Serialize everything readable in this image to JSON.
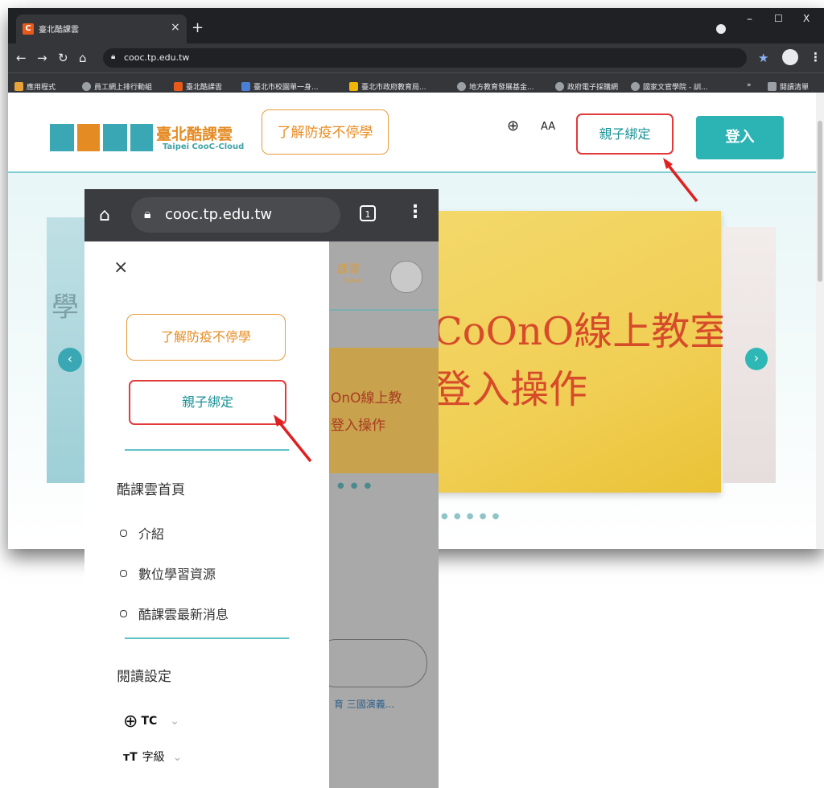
{
  "desktop": {
    "tab_title": "臺北酷課雲",
    "tab_close": "×",
    "new_tab": "+",
    "favicon": "C",
    "url": "cooc.tp.edu.tw",
    "bookmarks": [
      {
        "label": "應用程式",
        "color": "#e8a23a"
      },
      {
        "label": "員工網上排行動組",
        "color": "#8ab4f8"
      },
      {
        "label": "臺北酷課雲",
        "color": "#e85a19"
      },
      {
        "label": "臺北市校園單一身...",
        "color": "#4a7fd8"
      },
      {
        "label": "臺北市政府教育局...",
        "color": "#f2b705"
      },
      {
        "label": "地方教育發展基金...",
        "color": "#9aa0a6"
      },
      {
        "label": "政府電子採購網",
        "color": "#9aa0a6"
      },
      {
        "label": "國家文官學院 - 訓...",
        "color": "#9aa0a6"
      },
      {
        "label": "閱讀清單",
        "color": "#9aa0a6"
      }
    ],
    "bookmarks_more": "»",
    "window_controls": {
      "minimize": "–",
      "maximize": "☐",
      "close": "X"
    }
  },
  "site": {
    "logo_title": "臺北酷課雲",
    "logo_subtitle": "Taipei CooC-Cloud",
    "logo_colors": [
      "#3aa8b4",
      "#e58b23",
      "#3aa8b4",
      "#3aa8b4"
    ],
    "epidemic_button": "了解防疫不停學",
    "language_icon": "globe-icon",
    "font_size_label": "AA",
    "parent_bind_button": "親子綁定",
    "login_button": "登入",
    "banner_line1": "CoOnO線上教室",
    "banner_line2": "登入操作",
    "banner_left_char": "學",
    "arrow_left": "‹",
    "arrow_right": "›"
  },
  "mobile": {
    "url": "cooc.tp.edu.tw",
    "tab_count": "1",
    "close_label": "×",
    "epidemic_button": "了解防疫不停學",
    "parent_bind_button": "親子綁定",
    "home_label": "酷課雲首頁",
    "sub_items": [
      "介紹",
      "數位學習資源",
      "酷課雲最新消息"
    ],
    "reading_settings": "閱讀設定",
    "language_value": "TC",
    "font_level_label": "字級",
    "behind_logo": "課雲",
    "behind_logo_sub": "Cloud",
    "behind_slide_line1": "OnO線上教",
    "behind_slide_line2": "登入操作",
    "behind_keywords": "育 三國演義..."
  },
  "colors": {
    "accent_teal": "#2cb3b4",
    "highlight_red": "#e23a3a",
    "orange": "#e88b20"
  }
}
